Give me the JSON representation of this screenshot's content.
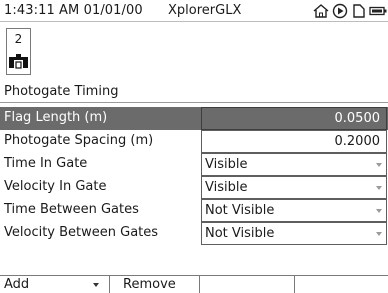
{
  "status_bar": {
    "clock": "1:43:11 AM  01/01/00",
    "app_name": "XplorerGLX",
    "icons": [
      "home-icon",
      "play-icon",
      "file-icon",
      "battery-icon"
    ]
  },
  "sensor": {
    "number": "2",
    "icon": "photogate-icon"
  },
  "section": {
    "title": "Photogate Timing"
  },
  "properties": [
    {
      "label": "Flag Length (m)",
      "value": "0.0500",
      "kind": "number",
      "selected": true
    },
    {
      "label": "Photogate Spacing (m)",
      "value": "0.2000",
      "kind": "number",
      "selected": false
    },
    {
      "label": "Time In Gate",
      "value": "Visible",
      "kind": "dropdown",
      "selected": false
    },
    {
      "label": "Velocity In Gate",
      "value": "Visible",
      "kind": "dropdown",
      "selected": false
    },
    {
      "label": "Time Between Gates",
      "value": "Not Visible",
      "kind": "dropdown",
      "selected": false
    },
    {
      "label": "Velocity Between Gates",
      "value": "Not Visible",
      "kind": "dropdown",
      "selected": false
    }
  ],
  "softkeys": [
    {
      "label": "Add",
      "has_menu": true
    },
    {
      "label": "Remove",
      "has_menu": false
    },
    {
      "label": "",
      "has_menu": false
    },
    {
      "label": "",
      "has_menu": false
    }
  ],
  "colors": {
    "selected_row": "#6b6b6b",
    "border": "#5e5e5e"
  }
}
